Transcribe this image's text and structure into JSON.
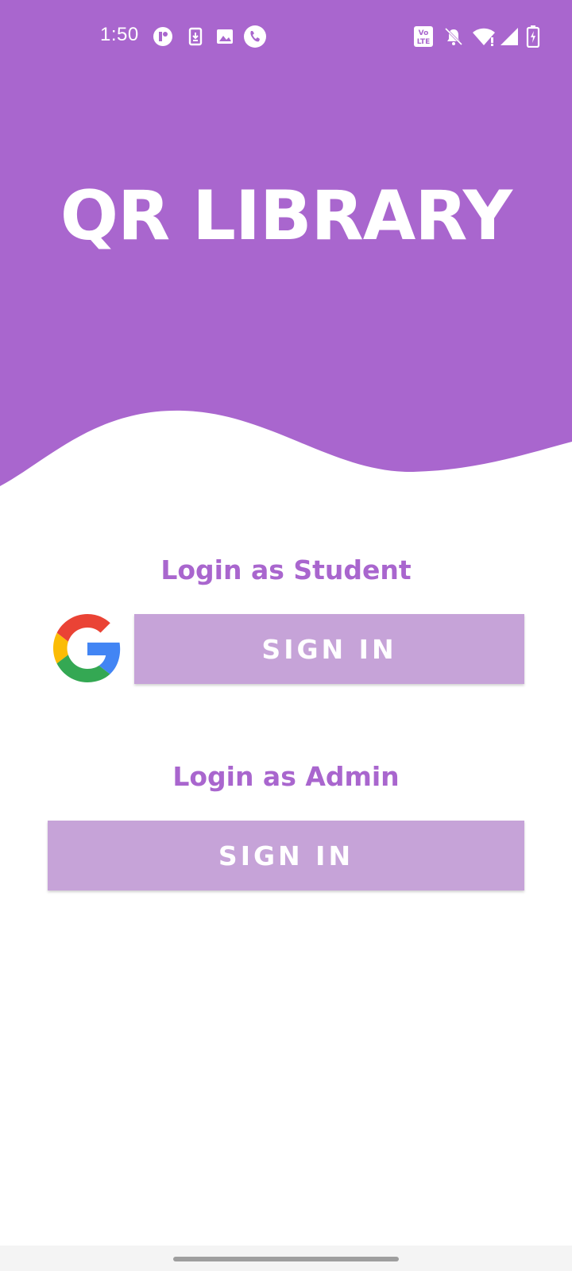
{
  "colors": {
    "primary": "#a966ce",
    "button": "#c6a3d8",
    "text_on_primary": "#ffffff",
    "nav_handle": "#9e9e9e"
  },
  "status_bar": {
    "time": "1:50",
    "left_icons": [
      "app-notification-icon",
      "download-icon",
      "image-icon",
      "phone-call-icon"
    ],
    "right_icons": [
      "volte-icon",
      "silent-bell-icon",
      "wifi-icon",
      "cellular-signal-icon",
      "battery-charging-icon"
    ],
    "volte_label": "Vo LTE"
  },
  "header": {
    "title": "QR LIBRARY"
  },
  "student": {
    "heading": "Login as Student",
    "icon": "google-icon",
    "button_label": "SIGN IN"
  },
  "admin": {
    "heading": "Login as Admin",
    "button_label": "SIGN IN"
  }
}
